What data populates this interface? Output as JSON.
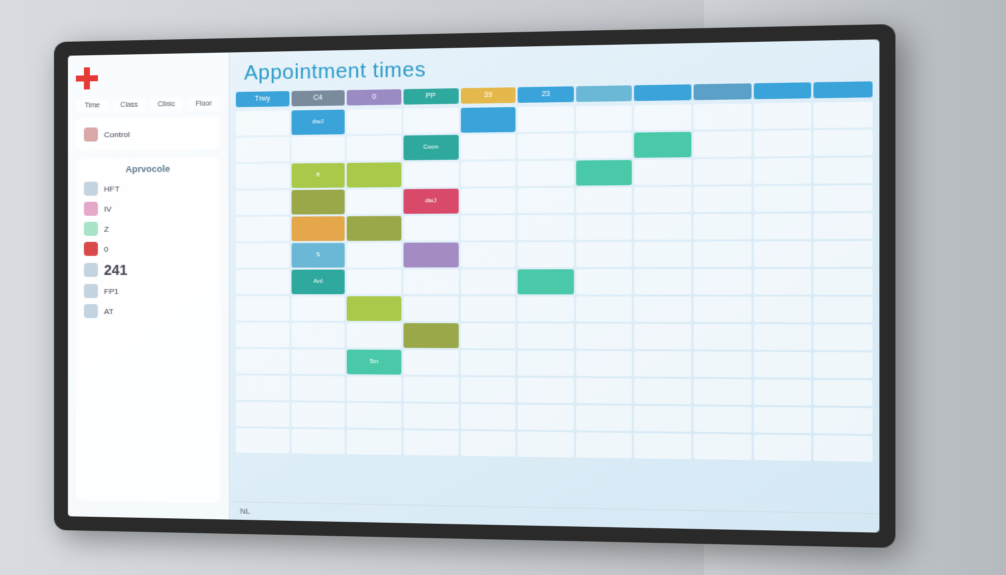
{
  "header": {
    "title": "Appointment times"
  },
  "sidebar": {
    "tabs": [
      "Time",
      "Class",
      "Clinic",
      "Floor"
    ],
    "panel1_label": "Control",
    "panel2_title": "Aprvocole",
    "rows": [
      {
        "label": "HFT"
      },
      {
        "label": "IV"
      },
      {
        "label": "Z"
      },
      {
        "label": "0"
      },
      {
        "label": "241"
      },
      {
        "label": "FP1"
      },
      {
        "label": "AT"
      }
    ]
  },
  "columns": [
    {
      "label": "Trwy"
    },
    {
      "label": "C4"
    },
    {
      "label": "0"
    },
    {
      "label": "PP"
    },
    {
      "label": "39"
    },
    {
      "label": "23"
    },
    {
      "label": ""
    },
    {
      "label": ""
    },
    {
      "label": ""
    },
    {
      "label": ""
    },
    {
      "label": ""
    }
  ],
  "grid_cells": [
    [
      "",
      "dwJ",
      "",
      "",
      "",
      "",
      "",
      "",
      "",
      "",
      ""
    ],
    [
      "",
      "",
      "",
      "Coon",
      "",
      "",
      "",
      "",
      "",
      "",
      ""
    ],
    [
      "",
      "8",
      "",
      "",
      "",
      "",
      "",
      "",
      "",
      "",
      ""
    ],
    [
      "",
      "",
      "",
      "dwJ",
      "",
      "",
      "",
      "",
      "",
      "",
      ""
    ],
    [
      "",
      "",
      "",
      "",
      "",
      "",
      "",
      "",
      "",
      "",
      ""
    ],
    [
      "",
      "S",
      "",
      "",
      "",
      "",
      "",
      "",
      "",
      "",
      ""
    ],
    [
      "",
      "AnI",
      "",
      "",
      "",
      "",
      "",
      "",
      "",
      "",
      ""
    ],
    [
      "",
      "",
      "",
      "",
      "",
      "",
      "",
      "",
      "",
      "",
      ""
    ],
    [
      "",
      "",
      "",
      "",
      "",
      "",
      "",
      "",
      "",
      "",
      ""
    ],
    [
      "",
      "",
      "5m",
      "",
      "",
      "",
      "",
      "",
      "",
      "",
      ""
    ],
    [
      "",
      "",
      "",
      "",
      "",
      "",
      "",
      "",
      "",
      "",
      ""
    ],
    [
      "",
      "",
      "",
      "",
      "",
      "",
      "",
      "",
      "",
      "",
      ""
    ],
    [
      "",
      "",
      "",
      "",
      "",
      "",
      "",
      "",
      "",
      "",
      ""
    ]
  ],
  "footer": {
    "text": "NL"
  }
}
